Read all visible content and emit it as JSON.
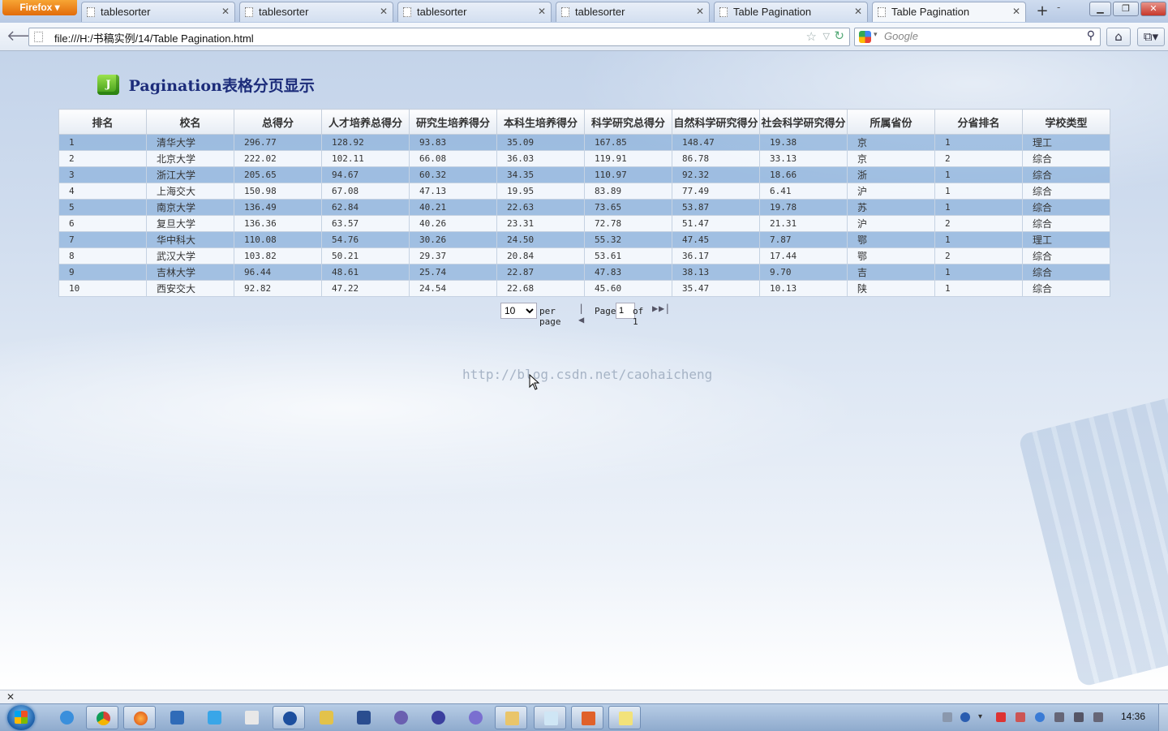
{
  "browser": {
    "app_button": "Firefox",
    "tabs": [
      {
        "label": "tablesorter",
        "active": false
      },
      {
        "label": "tablesorter",
        "active": false
      },
      {
        "label": "tablesorter",
        "active": false
      },
      {
        "label": "tablesorter",
        "active": false
      },
      {
        "label": "Table Pagination",
        "active": false
      },
      {
        "label": "Table Pagination",
        "active": true
      }
    ],
    "url": "file:///H:/书稿实例/14/Table Pagination.html",
    "search_placeholder": "Google"
  },
  "page": {
    "title": "Pagination表格分页显示",
    "title_icon_letter": "J",
    "watermark": "http://blog.csdn.net/caohaicheng"
  },
  "table": {
    "headers": [
      "排名",
      "校名",
      "总得分",
      "人才培养总得分",
      "研究生培养得分",
      "本科生培养得分",
      "科学研究总得分",
      "自然科学研究得分",
      "社会科学研究得分",
      "所属省份",
      "分省排名",
      "学校类型"
    ],
    "rows": [
      [
        "1",
        "清华大学",
        "296.77",
        "128.92",
        "93.83",
        "35.09",
        "167.85",
        "148.47",
        "19.38",
        "京",
        "1",
        "理工"
      ],
      [
        "2",
        "北京大学",
        "222.02",
        "102.11",
        "66.08",
        "36.03",
        "119.91",
        "86.78",
        "33.13",
        "京",
        "2",
        "综合"
      ],
      [
        "3",
        "浙江大学",
        "205.65",
        "94.67",
        "60.32",
        "34.35",
        "110.97",
        "92.32",
        "18.66",
        "浙",
        "1",
        "综合"
      ],
      [
        "4",
        "上海交大",
        "150.98",
        "67.08",
        "47.13",
        "19.95",
        "83.89",
        "77.49",
        "6.41",
        "沪",
        "1",
        "综合"
      ],
      [
        "5",
        "南京大学",
        "136.49",
        "62.84",
        "40.21",
        "22.63",
        "73.65",
        "53.87",
        "19.78",
        "苏",
        "1",
        "综合"
      ],
      [
        "6",
        "复旦大学",
        "136.36",
        "63.57",
        "40.26",
        "23.31",
        "72.78",
        "51.47",
        "21.31",
        "沪",
        "2",
        "综合"
      ],
      [
        "7",
        "华中科大",
        "110.08",
        "54.76",
        "30.26",
        "24.50",
        "55.32",
        "47.45",
        "7.87",
        "鄂",
        "1",
        "理工"
      ],
      [
        "8",
        "武汉大学",
        "103.82",
        "50.21",
        "29.37",
        "20.84",
        "53.61",
        "36.17",
        "17.44",
        "鄂",
        "2",
        "综合"
      ],
      [
        "9",
        "吉林大学",
        "96.44",
        "48.61",
        "25.74",
        "22.87",
        "47.83",
        "38.13",
        "9.70",
        "吉",
        "1",
        "综合"
      ],
      [
        "10",
        "西安交大",
        "92.82",
        "47.22",
        "24.54",
        "22.68",
        "45.60",
        "35.47",
        "10.13",
        "陕",
        "1",
        "综合"
      ]
    ]
  },
  "pager": {
    "per_page_value": "10",
    "per_page_label": "per page",
    "page_label": "Page",
    "page_value": "1",
    "of_label": "of 1"
  },
  "taskbar": {
    "clock": "14:36"
  },
  "colors": {
    "title": "#1c2c7a",
    "row_odd": "#8db4de",
    "row_even": "#f5f9fd"
  }
}
